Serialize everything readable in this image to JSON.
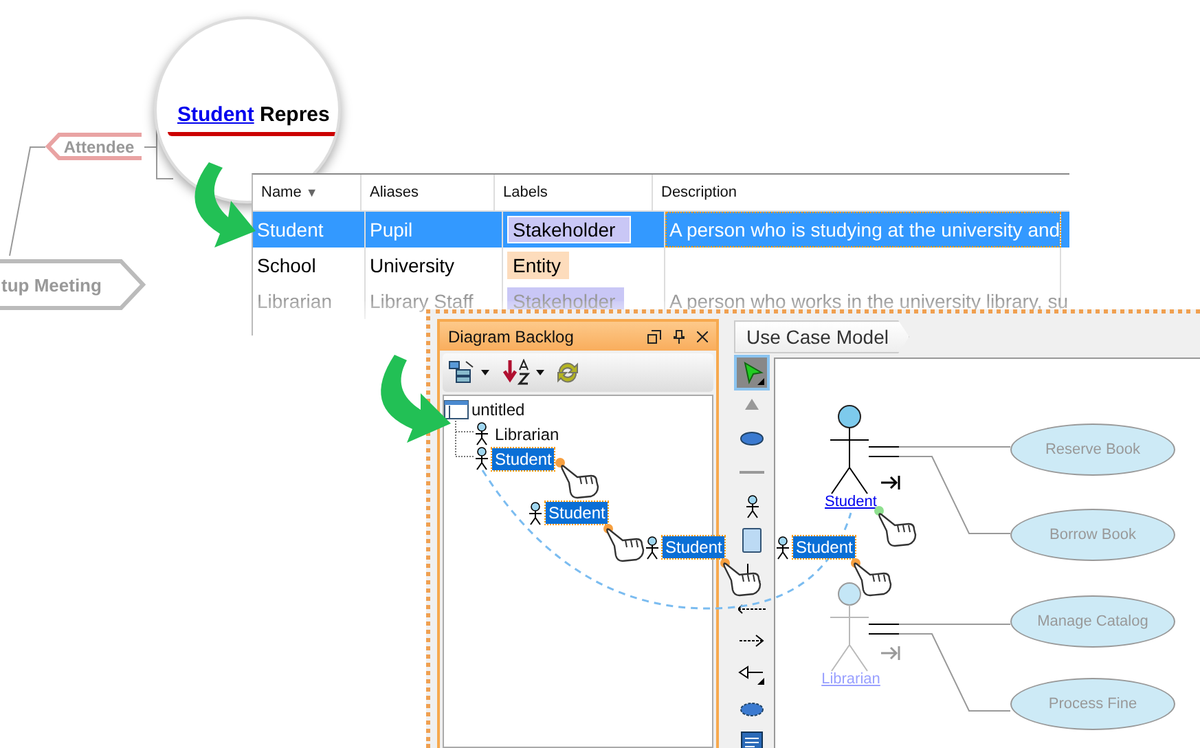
{
  "mind_map": {
    "topics": [
      {
        "label": "Attendee",
        "kind": "subtopic"
      },
      {
        "label": "tup Meeting",
        "kind": "central"
      }
    ]
  },
  "magnifier": {
    "link": "Student",
    "text": "Repres"
  },
  "table": {
    "columns": [
      {
        "label": "Name",
        "sort_icon": "▼"
      },
      {
        "label": "Aliases"
      },
      {
        "label": "Labels"
      },
      {
        "label": "Description"
      }
    ],
    "rows": [
      {
        "name": "Student",
        "alias": "Pupil",
        "label": {
          "text": "Stakeholder",
          "color": "#c9c7f6"
        },
        "description": "A person who is studying at the university and",
        "selected": true,
        "faded": false
      },
      {
        "name": "School",
        "alias": "University",
        "label": {
          "text": "Entity",
          "color": "#fddcbc"
        },
        "selected": false,
        "faded": false
      },
      {
        "name": "Librarian",
        "alias": "Library Staff",
        "label": {
          "text": "Stakeholder",
          "color": "#c9c7f6"
        },
        "description": "A person who works in the university library, su",
        "selected": false,
        "faded": true
      }
    ]
  },
  "backlog": {
    "title": "Diagram Backlog",
    "tree": {
      "label": "untitled",
      "selected": false,
      "children": [
        {
          "label": "Librarian",
          "selected": false
        },
        {
          "label": "Student",
          "selected": true
        }
      ]
    }
  },
  "drag_labels": [
    "Student",
    "Student",
    "Student"
  ],
  "diagram": {
    "breadcrumb": "Use Case Model",
    "tools": [
      {
        "kind": "pointer",
        "selected": true
      },
      {
        "kind": "collapse",
        "selected": false
      },
      {
        "kind": "usecase",
        "selected": false
      },
      {
        "kind": "line",
        "selected": false
      },
      {
        "kind": "actor",
        "selected": false
      },
      {
        "kind": "system",
        "selected": false
      },
      {
        "kind": "association",
        "selected": false
      },
      {
        "kind": "extend",
        "selected": false
      },
      {
        "kind": "dependency",
        "selected": false
      },
      {
        "kind": "generalization",
        "selected": false
      },
      {
        "kind": "business",
        "selected": false
      },
      {
        "kind": "note",
        "selected": false
      }
    ],
    "actors": [
      {
        "name": "Student",
        "faded": false
      },
      {
        "name": "Librarian",
        "faded": true
      }
    ],
    "use_cases": [
      "Reserve Book",
      "Borrow Book",
      "Manage Catalog",
      "Process Fine"
    ]
  }
}
